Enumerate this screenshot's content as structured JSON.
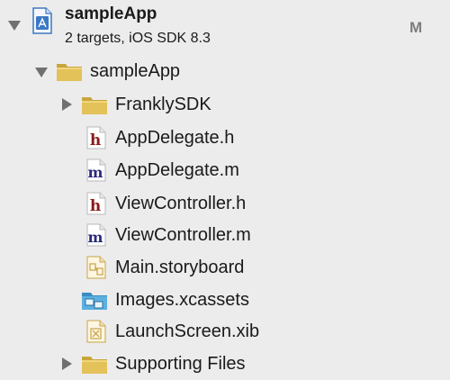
{
  "project": {
    "name": "sampleApp",
    "subtitle": "2 targets, iOS SDK 8.3",
    "badge": "M",
    "icon": "xcode-project-icon"
  },
  "tree": [
    {
      "label": "sampleApp",
      "icon": "folder-icon",
      "disclosure": "expanded"
    },
    {
      "label": "FranklySDK",
      "icon": "folder-icon",
      "disclosure": "collapsed"
    },
    {
      "label": "AppDelegate.h",
      "icon": "header-file-icon",
      "letter": "h"
    },
    {
      "label": "AppDelegate.m",
      "icon": "implementation-file-icon",
      "letter": "m"
    },
    {
      "label": "ViewController.h",
      "icon": "header-file-icon",
      "letter": "h"
    },
    {
      "label": "ViewController.m",
      "icon": "implementation-file-icon",
      "letter": "m"
    },
    {
      "label": "Main.storyboard",
      "icon": "storyboard-file-icon"
    },
    {
      "label": "Images.xcassets",
      "icon": "asset-catalog-icon"
    },
    {
      "label": "LaunchScreen.xib",
      "icon": "xib-file-icon"
    },
    {
      "label": "Supporting Files",
      "icon": "folder-icon",
      "disclosure": "collapsed"
    }
  ],
  "colors": {
    "background": "#ececec",
    "folder": "#d9b74a",
    "header_letter": "#8b1a1a",
    "impl_letter": "#2a2a7a",
    "asset": "#4da3d6",
    "badge": "#7d7d7d"
  }
}
